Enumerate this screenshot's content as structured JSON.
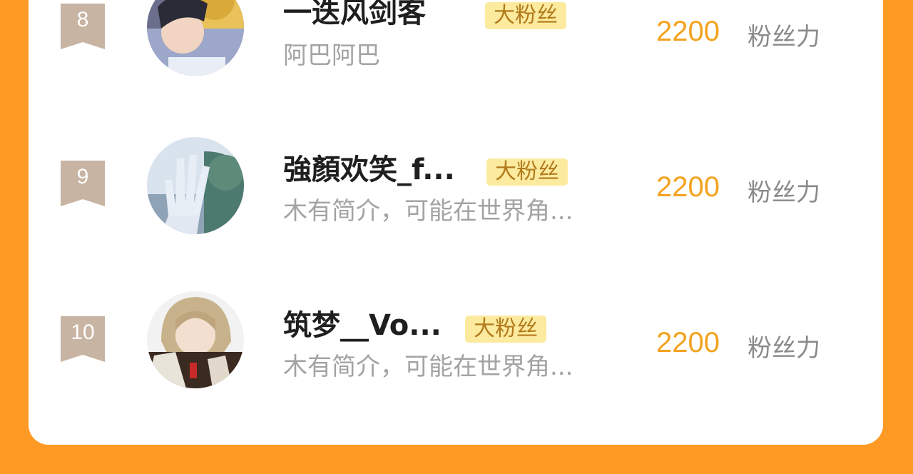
{
  "list": {
    "rows": [
      {
        "rank": "8",
        "name": "一迭风剑客",
        "badge": "大粉丝",
        "bio": "阿巴阿巴",
        "score": "2200",
        "score_unit": "粉丝力",
        "avatar_icon": "anime-knight-avatar"
      },
      {
        "rank": "9",
        "name": "強顏欢笑_f...",
        "badge": "大粉丝",
        "bio": "木有简介，可能在世界角...",
        "score": "2200",
        "score_unit": "粉丝力",
        "avatar_icon": "hand-tree-avatar"
      },
      {
        "rank": "10",
        "name": "筑梦__Vo...",
        "badge": "大粉丝",
        "bio": "木有简介，可能在世界角...",
        "score": "2200",
        "score_unit": "粉丝力",
        "avatar_icon": "anime-blonde-avatar"
      }
    ]
  },
  "colors": {
    "background": "#FF9A24",
    "rank_badge": "#C8B4A2",
    "score": "#F4A21E",
    "fan_badge_bg": "#FCEB9F"
  }
}
